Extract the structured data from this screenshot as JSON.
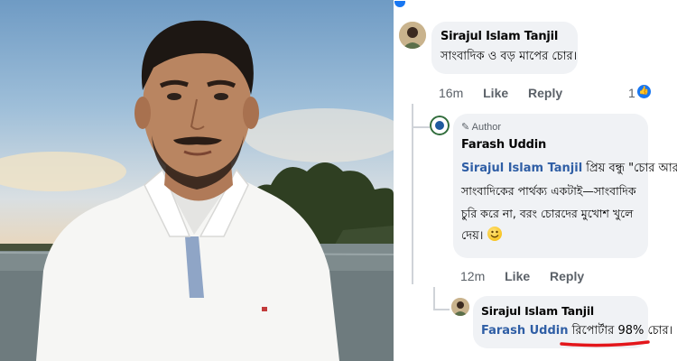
{
  "comments": [
    {
      "author": "Sirajul Islam Tanjil",
      "text": "সাংবাদিক ও বড় মাপের চোর।",
      "time": "16m",
      "like_label": "Like",
      "reply_label": "Reply",
      "reaction_count": "1"
    },
    {
      "author_badge": "Author",
      "author": "Farash Uddin",
      "mention": "Sirajul Islam Tanjil",
      "text_line1": " প্রিয় বন্ধু \"চোর আর",
      "text_line2": "সাংবাদিকের পার্থক্য একটাই—সাংবাদিক",
      "text_line3": "চুরি করে না, বরং চোরদের মুখোশ খুলে",
      "text_line4": "দেয়।",
      "time": "12m",
      "like_label": "Like",
      "reply_label": "Reply"
    },
    {
      "author": "Sirajul Islam Tanjil",
      "mention": "Farash Uddin",
      "text": " রিপোর্টার 98% চোর।"
    }
  ],
  "colors": {
    "mention": "#2f5ea5",
    "like_badge": "#1877f2",
    "bubble": "#f0f2f5",
    "underline": "#e3161b"
  },
  "icons": [
    "like-reaction-icon",
    "pencil-icon",
    "smile-emoji-icon"
  ]
}
